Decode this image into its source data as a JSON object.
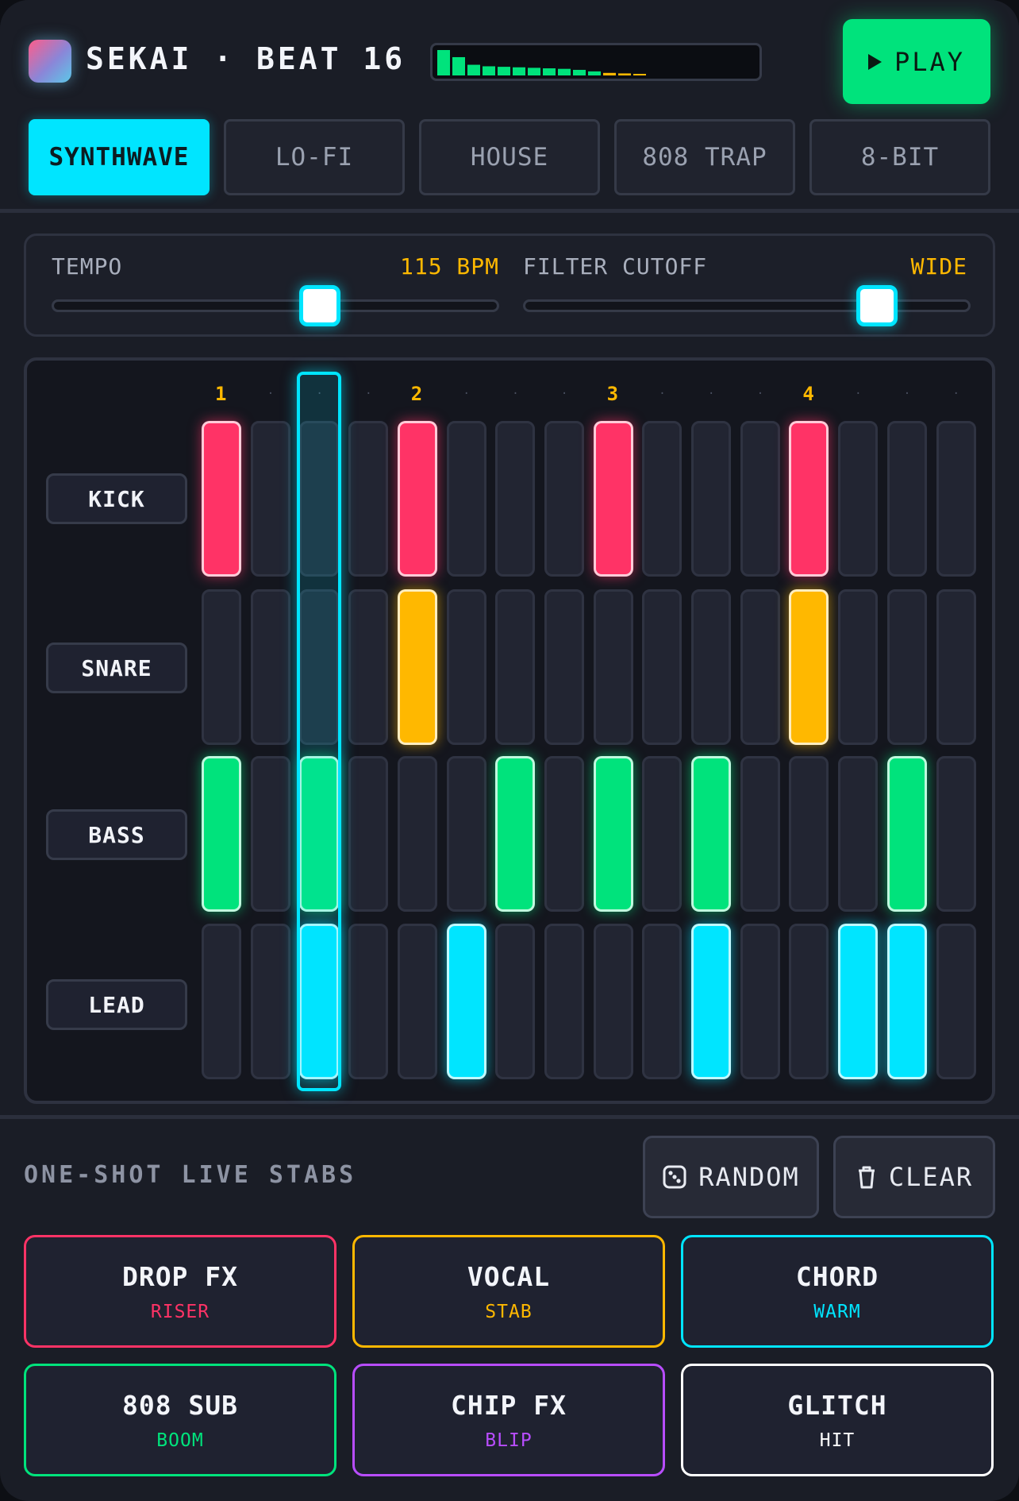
{
  "colors": {
    "kick": "#ff3366",
    "snare": "#ffb800",
    "bass": "#00e37c",
    "lead": "#00e5ff",
    "accent": "#00e5ff",
    "play": "#00e37c"
  },
  "header": {
    "title": "SEKAI · BEAT 16",
    "play_label": "PLAY",
    "meter_levels": [
      1.0,
      0.72,
      0.42,
      0.36,
      0.34,
      0.32,
      0.3,
      0.28,
      0.26,
      0.22,
      0.16,
      0.1,
      0.08,
      0.06
    ]
  },
  "tabs": [
    {
      "label": "SYNTHWAVE",
      "active": true
    },
    {
      "label": "LO-FI",
      "active": false
    },
    {
      "label": "HOUSE",
      "active": false
    },
    {
      "label": "808 TRAP",
      "active": false
    },
    {
      "label": "8-BIT",
      "active": false
    }
  ],
  "controls": {
    "tempo": {
      "label": "TEMPO",
      "value": "115 BPM",
      "position": 0.6
    },
    "filter": {
      "label": "FILTER CUTOFF",
      "value": "WIDE",
      "position": 0.79
    }
  },
  "sequencer": {
    "beat_labels": [
      "1",
      "2",
      "3",
      "4"
    ],
    "current_step": 3,
    "rows": [
      {
        "label": "KICK",
        "color": "kick",
        "steps": [
          1,
          0,
          0,
          0,
          1,
          0,
          0,
          0,
          1,
          0,
          0,
          0,
          1,
          0,
          0,
          0
        ]
      },
      {
        "label": "SNARE",
        "color": "snare",
        "steps": [
          0,
          0,
          0,
          0,
          1,
          0,
          0,
          0,
          0,
          0,
          0,
          0,
          1,
          0,
          0,
          0
        ]
      },
      {
        "label": "BASS",
        "color": "bass",
        "steps": [
          1,
          0,
          1,
          0,
          0,
          0,
          1,
          0,
          1,
          0,
          1,
          0,
          0,
          0,
          1,
          0
        ]
      },
      {
        "label": "LEAD",
        "color": "lead",
        "steps": [
          0,
          0,
          1,
          0,
          0,
          1,
          0,
          0,
          0,
          0,
          1,
          0,
          0,
          1,
          1,
          0
        ]
      }
    ]
  },
  "stabs": {
    "title": "ONE-SHOT LIVE STABS",
    "random_label": "RANDOM",
    "clear_label": "CLEAR",
    "pads": [
      {
        "title": "DROP FX",
        "sub": "RISER",
        "color": "#ff3366"
      },
      {
        "title": "VOCAL",
        "sub": "STAB",
        "color": "#ffb800"
      },
      {
        "title": "CHORD",
        "sub": "WARM",
        "color": "#00e5ff"
      },
      {
        "title": "808 SUB",
        "sub": "BOOM",
        "color": "#00e37c"
      },
      {
        "title": "CHIP FX",
        "sub": "BLIP",
        "color": "#b84dff"
      },
      {
        "title": "GLITCH",
        "sub": "HIT",
        "color": "#ffffff"
      }
    ]
  }
}
